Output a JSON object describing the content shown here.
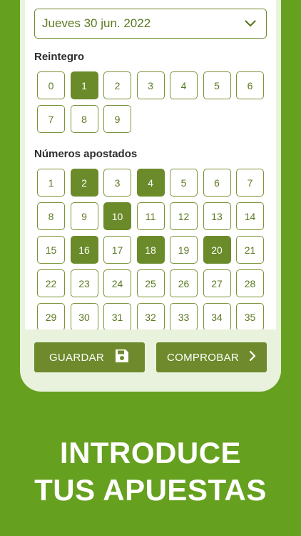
{
  "date_select": {
    "value": "Jueves 30 jun. 2022",
    "icon": "chevron-down-icon"
  },
  "reintegro": {
    "label": "Reintegro",
    "numbers": [
      "0",
      "1",
      "2",
      "3",
      "4",
      "5",
      "6",
      "7",
      "8",
      "9"
    ],
    "selected": [
      "1"
    ]
  },
  "apostados": {
    "label": "Números apostados",
    "numbers": [
      "1",
      "2",
      "3",
      "4",
      "5",
      "6",
      "7",
      "8",
      "9",
      "10",
      "11",
      "12",
      "13",
      "14",
      "15",
      "16",
      "17",
      "18",
      "19",
      "20",
      "21",
      "22",
      "23",
      "24",
      "25",
      "26",
      "27",
      "28",
      "29",
      "30",
      "31",
      "32",
      "33",
      "34",
      "35"
    ],
    "selected": [
      "2",
      "4",
      "10",
      "16",
      "18",
      "20"
    ]
  },
  "buttons": {
    "save_label": "GUARDAR",
    "save_icon": "floppy-disk-icon",
    "check_label": "COMPROBAR",
    "check_icon": "chevron-right-icon"
  },
  "headline": {
    "line1": "INTRODUCE",
    "line2": "TUS APUESTAS"
  },
  "colors": {
    "background": "#66a01f",
    "accent": "#6b8a2a",
    "footer": "#e9f2dc"
  }
}
